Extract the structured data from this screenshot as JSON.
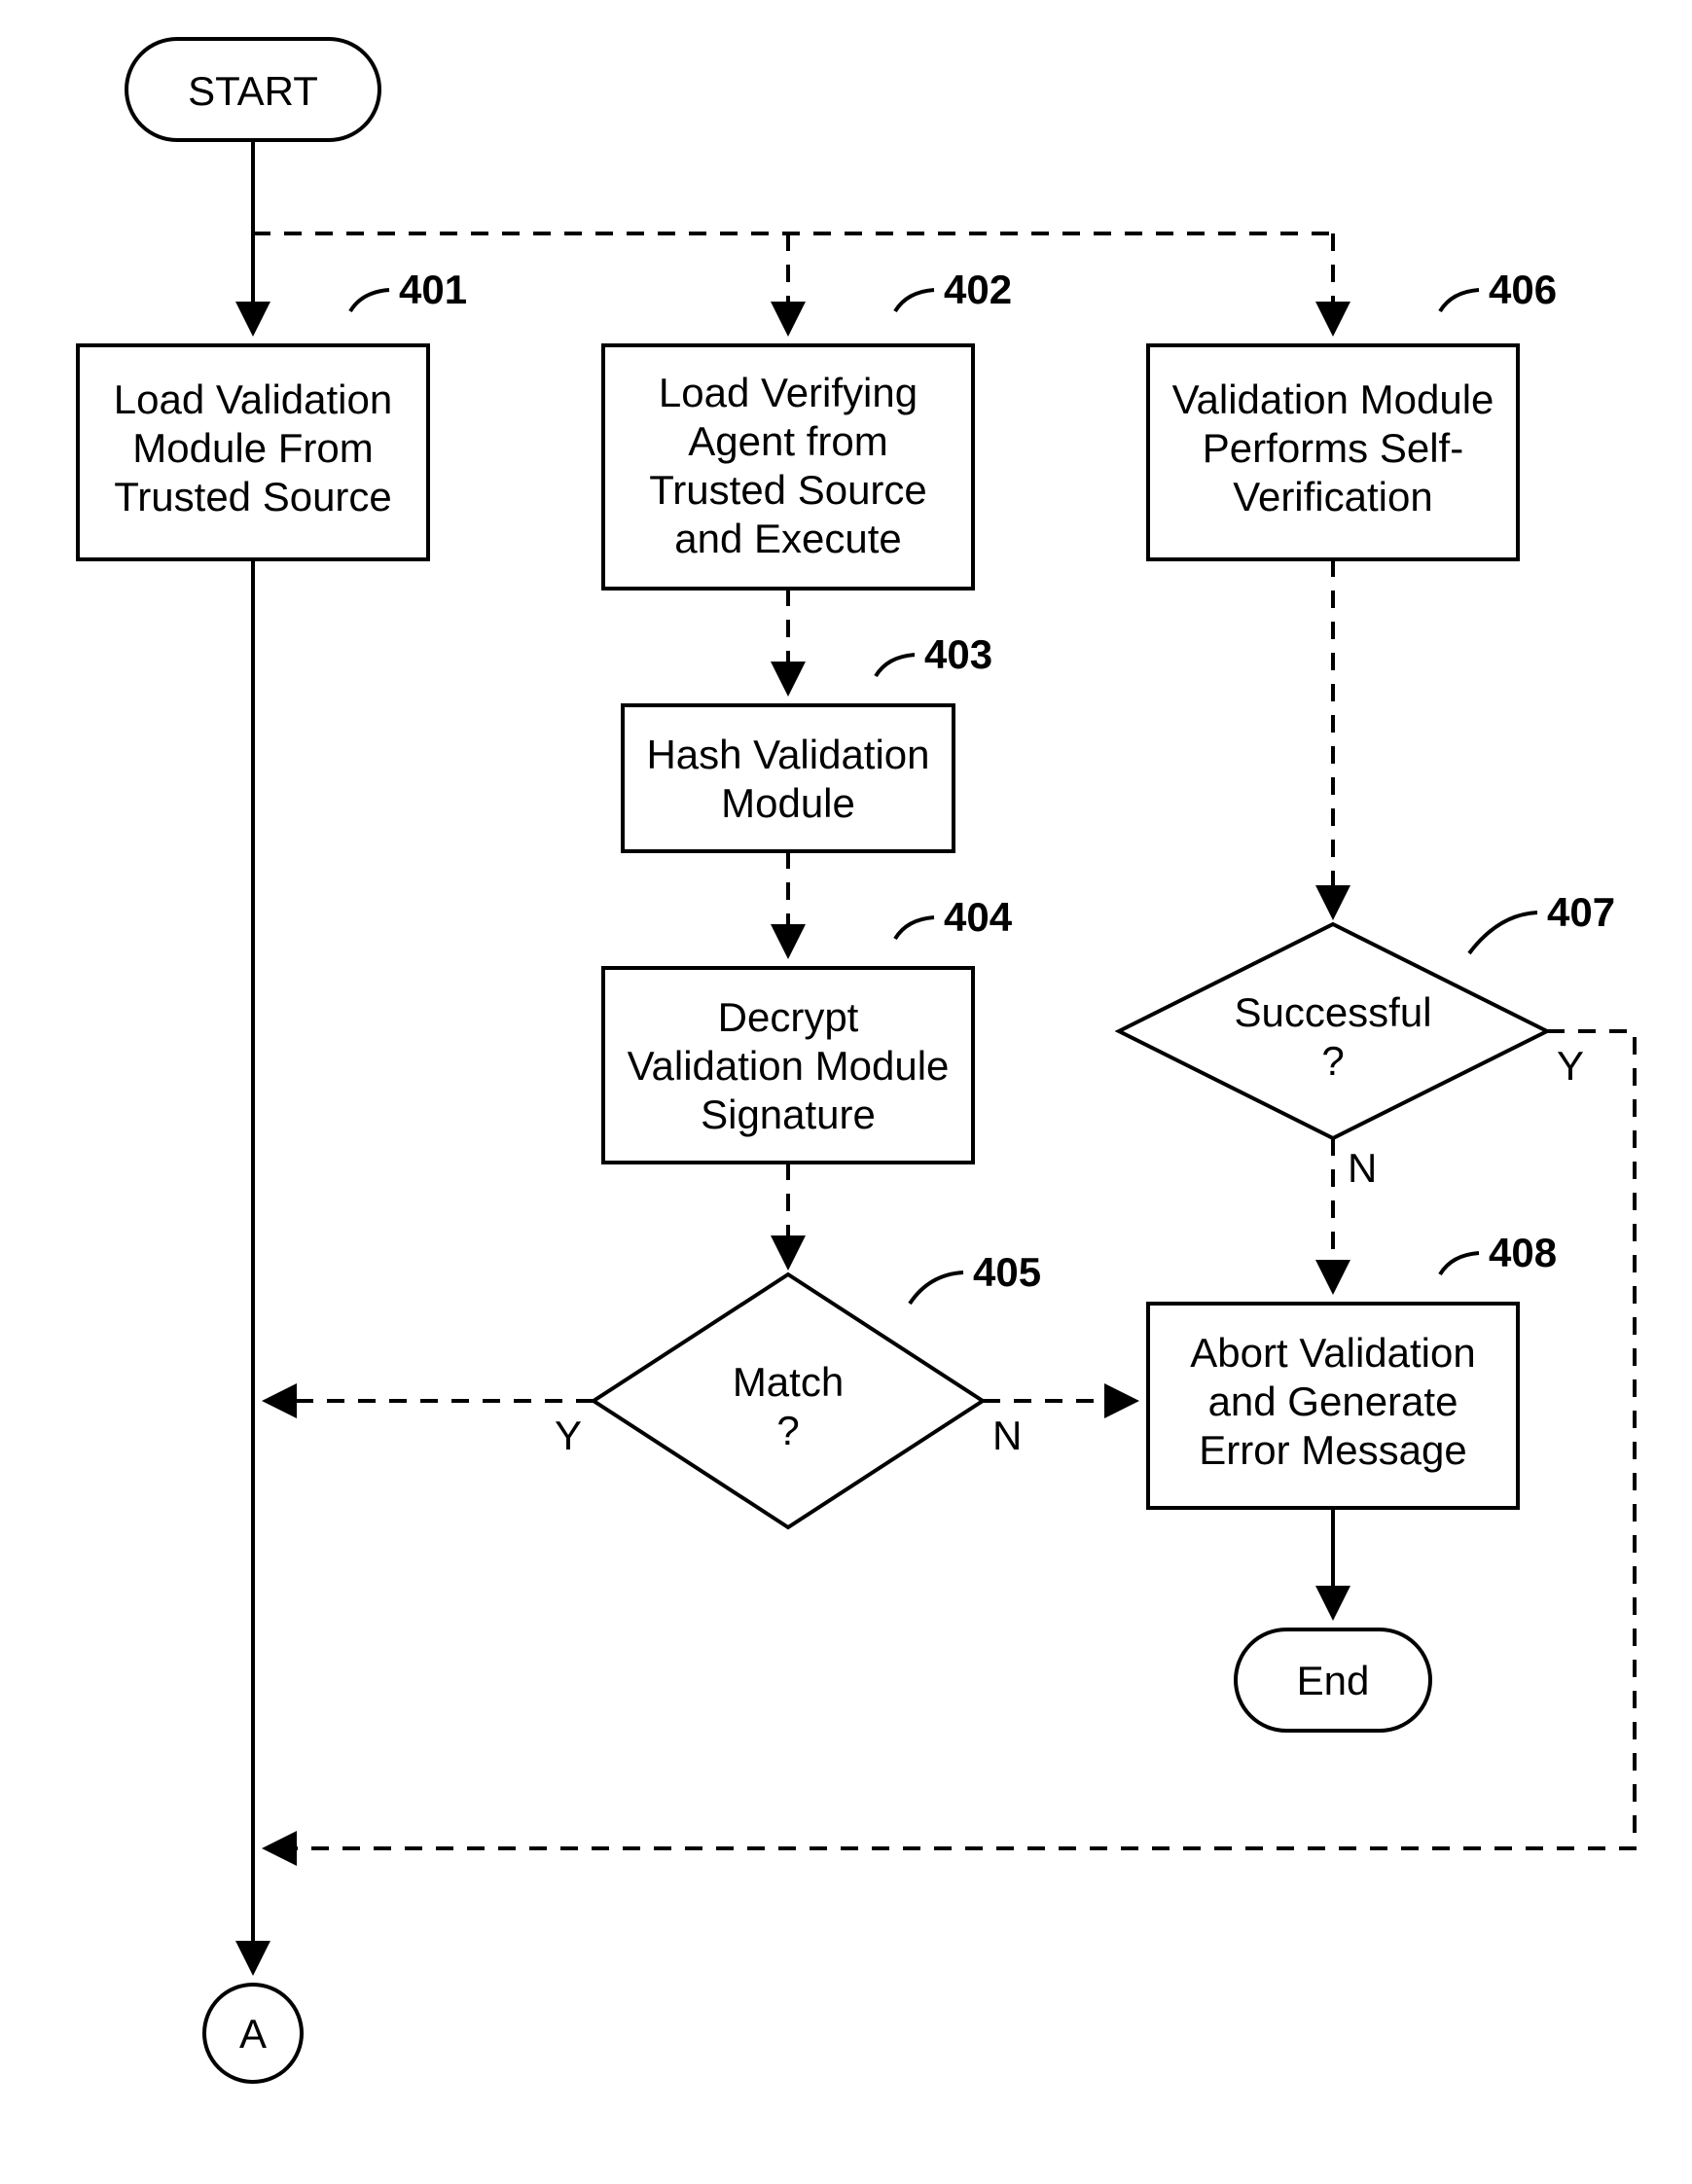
{
  "flow": {
    "start": "START",
    "connector": "A",
    "end": "End",
    "labels": {
      "step401": "401",
      "step402": "402",
      "step403": "403",
      "step404": "404",
      "step405": "405",
      "step406": "406",
      "step407": "407",
      "step408": "408"
    },
    "text": {
      "b401_l1": "Load Validation",
      "b401_l2": "Module From",
      "b401_l3": "Trusted Source",
      "b402_l1": "Load Verifying",
      "b402_l2": "Agent from",
      "b402_l3": "Trusted Source",
      "b402_l4": "and Execute",
      "b403_l1": "Hash Validation",
      "b403_l2": "Module",
      "b404_l1": "Decrypt",
      "b404_l2": "Validation Module",
      "b404_l3": "Signature",
      "d405_l1": "Match",
      "d405_l2": "?",
      "b406_l1": "Validation Module",
      "b406_l2": "Performs Self-",
      "b406_l3": "Verification",
      "d407_l1": "Successful",
      "d407_l2": "?",
      "b408_l1": "Abort Validation",
      "b408_l2": "and Generate",
      "b408_l3": "Error Message"
    },
    "branches": {
      "Y": "Y",
      "N": "N"
    }
  }
}
